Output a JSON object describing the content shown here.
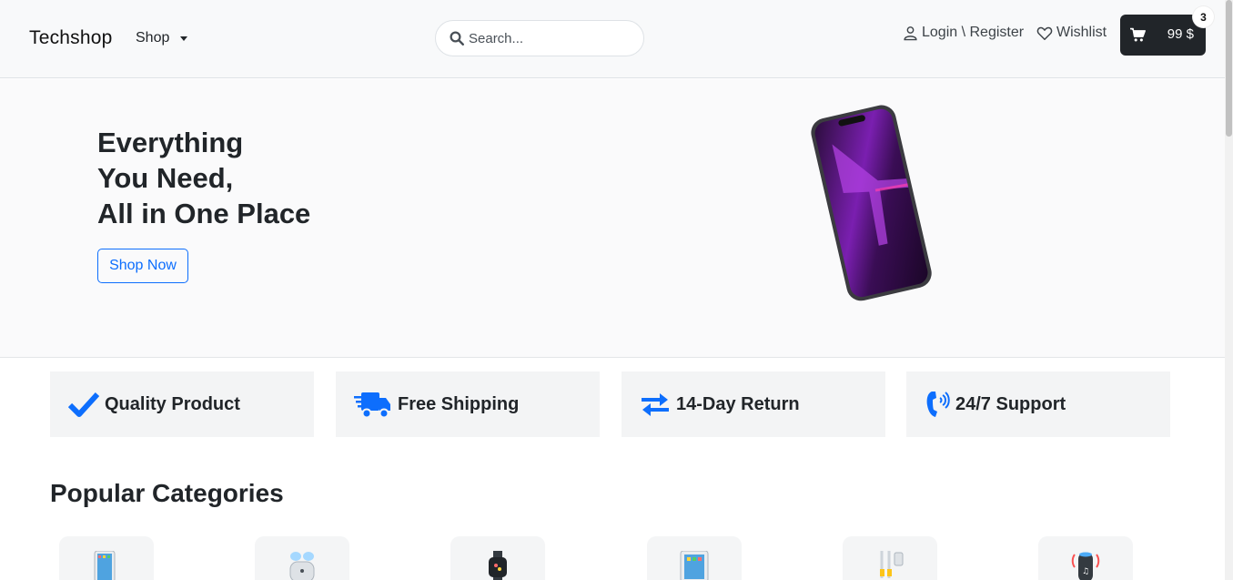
{
  "navbar": {
    "brand": "Techshop",
    "shop_label": "Shop",
    "search_placeholder": "Search...",
    "login_label": "Login \\ Register",
    "wishlist_label": "Wishlist",
    "cart_total": "99 $",
    "cart_count": "3"
  },
  "hero": {
    "title": "Everything\nYou Need,\nAll in One Place",
    "cta": "Shop Now"
  },
  "features": [
    {
      "label": "Quality Product",
      "icon": "check-icon"
    },
    {
      "label": "Free Shipping",
      "icon": "truck-icon"
    },
    {
      "label": "14-Day Return",
      "icon": "exchange-arrows-icon"
    },
    {
      "label": "24/7 Support",
      "icon": "phone-volume-icon"
    }
  ],
  "categories": {
    "heading": "Popular Categories",
    "items": [
      {
        "icon": "smartphone-icon"
      },
      {
        "icon": "earbuds-icon"
      },
      {
        "icon": "smartwatch-icon"
      },
      {
        "icon": "tablet-icon"
      },
      {
        "icon": "cables-icon"
      },
      {
        "icon": "smart-speaker-icon"
      }
    ]
  },
  "colors": {
    "accent": "#0d6efd",
    "dark": "#212529",
    "navbar_bg": "#f8f9fa",
    "feature_bg": "#f3f4f5"
  }
}
